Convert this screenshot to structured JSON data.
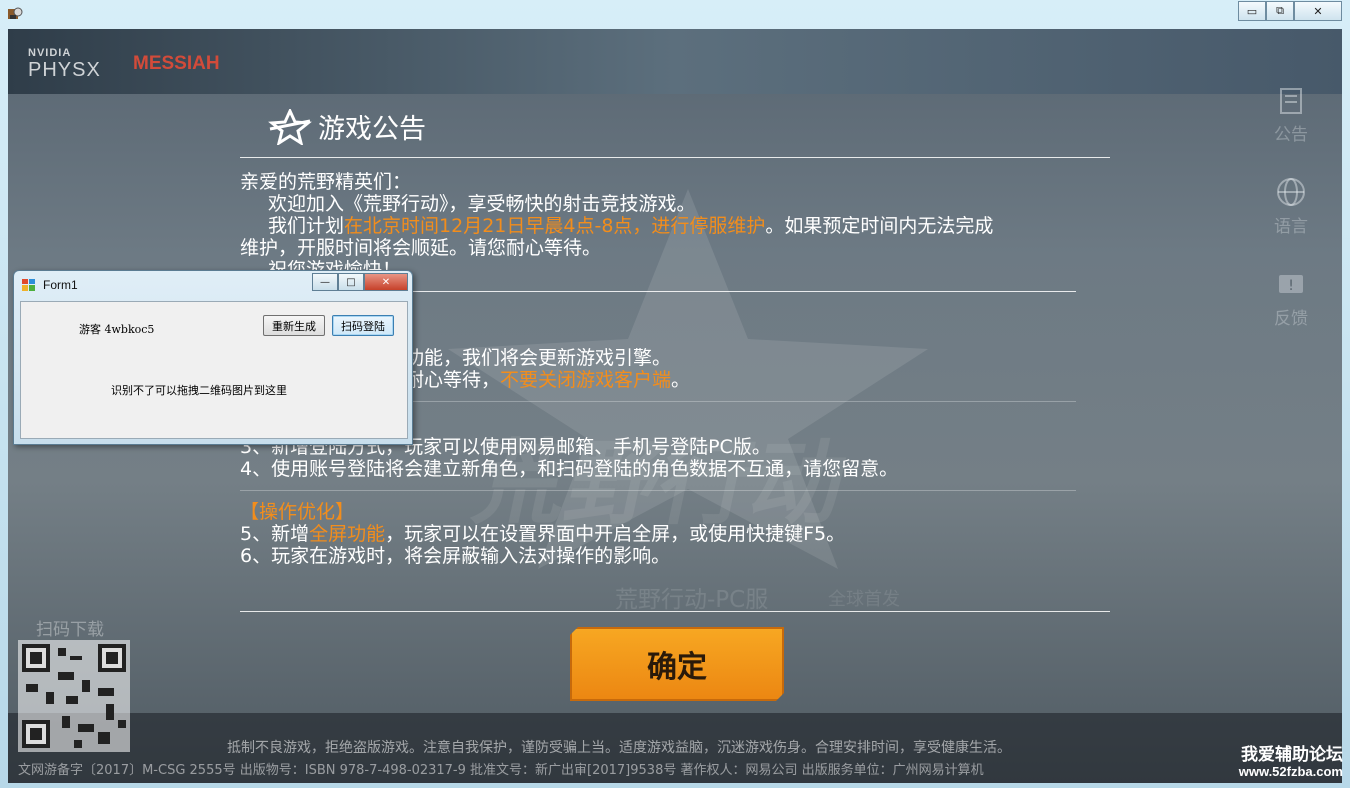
{
  "window": {
    "minimize_glyph": "▭",
    "restore_glyph": "⧉",
    "close_glyph": "✕"
  },
  "brand": {
    "nvidia_small": "NVIDIA",
    "nvidia_big": "PHYSX",
    "messiah": "MESSIAH"
  },
  "background": {
    "game_title_art": "荒野行动",
    "subtitle": "荒野行动-PC服",
    "subtitle2": "全球首发"
  },
  "side_menu": [
    {
      "label": "公告",
      "icon": "announcement-icon"
    },
    {
      "label": "语言",
      "icon": "globe-icon"
    },
    {
      "label": "反馈",
      "icon": "feedback-icon"
    }
  ],
  "notice": {
    "title": "游戏公告",
    "greeting": "亲爱的荒野精英们：",
    "welcome": "欢迎加入《荒野行动》，享受畅快的射击竞技游戏。",
    "plan_prefix": "我们计划",
    "plan_highlight": "在北京时间12月21日早晨4点-8点，进行停服维护",
    "plan_suffix": "。如果预定时间内无法完成",
    "plan_line2": "维护，开服时间将会顺延。请您耐心等待。",
    "wish": "祝您游戏愉快！",
    "item1_tail": "功能，我们将会更新游戏引擎。",
    "item2_tail": "耐心等待，",
    "item2_highlight": "不要关闭游戏客户端",
    "item2_end": "。",
    "item3": "3、新增登陆方式，玩家可以使用网易邮箱、手机号登陆PC版。",
    "item4": "4、使用账号登陆将会建立新角色，和扫码登陆的角色数据不互通，请您留意。",
    "section_optimize": "【操作优化】",
    "item5_prefix": "5、新增",
    "item5_highlight": "全屏功能",
    "item5_suffix": "，玩家可以在设置界面中开启全屏，或使用快捷键F5。",
    "item6": "6、玩家在游戏时，将会屏蔽输入法对操作的影响。"
  },
  "confirm_button": "确定",
  "qr": {
    "label": "扫码下载"
  },
  "footer": {
    "health_notice": "抵制不良游戏，拒绝盗版游戏。注意自我保护，谨防受骗上当。适度游戏益脑，沉迷游戏伤身。合理安排时间，享受健康生活。",
    "license": "文网游备字〔2017〕M-CSG 2555号     出版物号：ISBN 978-7-498-02317-9     批准文号：新广出审[2017]9538号     著作权人：网易公司     出版服务单位：广州网易计算机"
  },
  "watermark": {
    "line1": "我爱辅助论坛",
    "line2": "www.52fzba.com"
  },
  "form1": {
    "title": "Form1",
    "guest_label": "游客",
    "guest_code": "4wbkoc5",
    "regenerate_button": "重新生成",
    "scan_login_button": "扫码登陆",
    "drop_hint": "识别不了可以拖拽二维码图片到这里",
    "min_glyph": "—",
    "max_glyph": "□",
    "close_glyph": "✕"
  }
}
